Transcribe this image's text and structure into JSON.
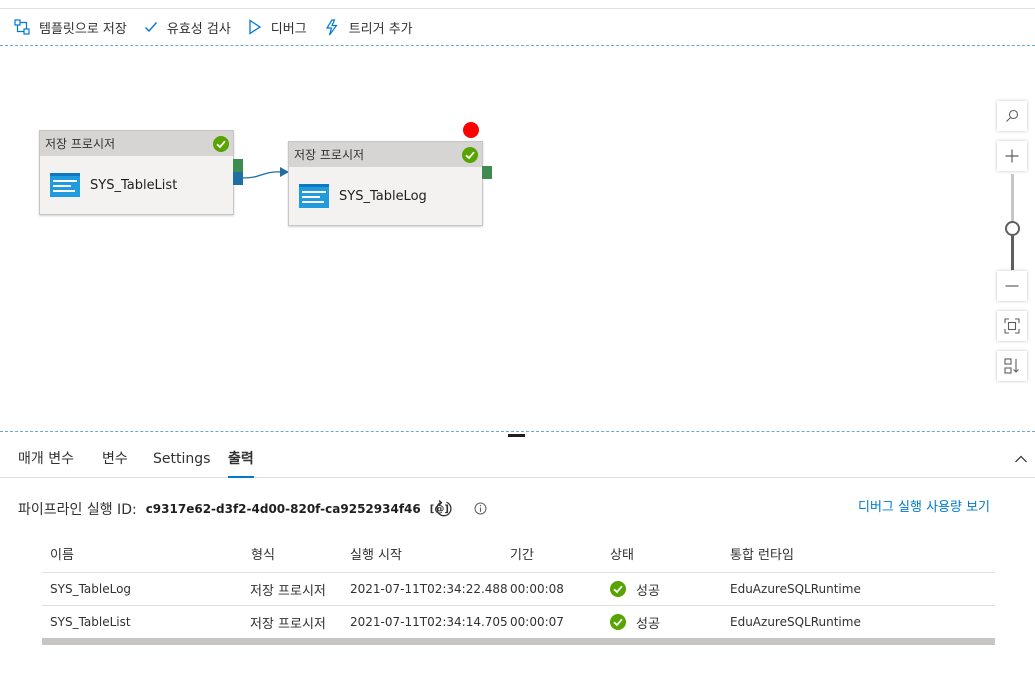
{
  "toolbar": {
    "save_template": "템플릿으로 저장",
    "validate": "유효성 검사",
    "debug": "디버그",
    "add_trigger": "트리거 추가"
  },
  "activities": [
    {
      "type": "저장 프로시저",
      "name": "SYS_TableList",
      "status": "succeeded"
    },
    {
      "type": "저장 프로시저",
      "name": "SYS_TableLog",
      "status": "succeeded"
    }
  ],
  "tabs": [
    "매개 변수",
    "변수",
    "Settings",
    "출력"
  ],
  "active_tab": "출력",
  "output": {
    "run_label": "파이프라인 실행 ID:",
    "run_id": "c9317e62-d3f2-4d00-820f-ca9252934f46",
    "copy_glyph": "[@]",
    "usage_link": "디버그 실행 사용량 보기",
    "columns": [
      "이름",
      "형식",
      "실행 시작",
      "기간",
      "상태",
      "통합 런타임"
    ],
    "rows": [
      {
        "name": "SYS_TableLog",
        "type": "저장 프로시저",
        "start": "2021-07-11T02:34:22.488",
        "duration": "00:00:08",
        "status": "성공",
        "runtime": "EduAzureSQLRuntime"
      },
      {
        "name": "SYS_TableList",
        "type": "저장 프로시저",
        "start": "2021-07-11T02:34:14.705",
        "duration": "00:00:07",
        "status": "성공",
        "runtime": "EduAzureSQLRuntime"
      }
    ]
  },
  "colors": {
    "accent": "#0078d4",
    "success": "#57a300",
    "breakpoint": "#ff0000",
    "port_green": "#3d8b4e",
    "port_blue": "#1f6fa5"
  }
}
